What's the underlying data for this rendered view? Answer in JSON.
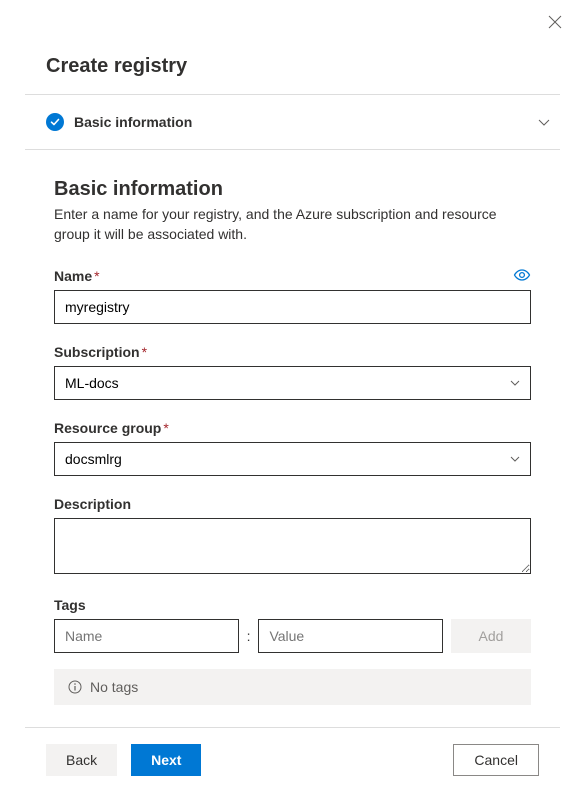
{
  "header": {
    "title": "Create registry"
  },
  "step": {
    "label": "Basic information"
  },
  "section": {
    "title": "Basic information",
    "description": "Enter a name for your registry, and the Azure subscription and resource group it will be associated with."
  },
  "fields": {
    "name": {
      "label": "Name",
      "value": "myregistry"
    },
    "subscription": {
      "label": "Subscription",
      "value": "ML-docs"
    },
    "resource_group": {
      "label": "Resource group",
      "value": "docsmlrg"
    },
    "description": {
      "label": "Description",
      "value": ""
    },
    "tags": {
      "label": "Tags",
      "name_placeholder": "Name",
      "value_placeholder": "Value",
      "add_label": "Add",
      "empty_text": "No tags"
    }
  },
  "footer": {
    "back": "Back",
    "next": "Next",
    "cancel": "Cancel"
  }
}
